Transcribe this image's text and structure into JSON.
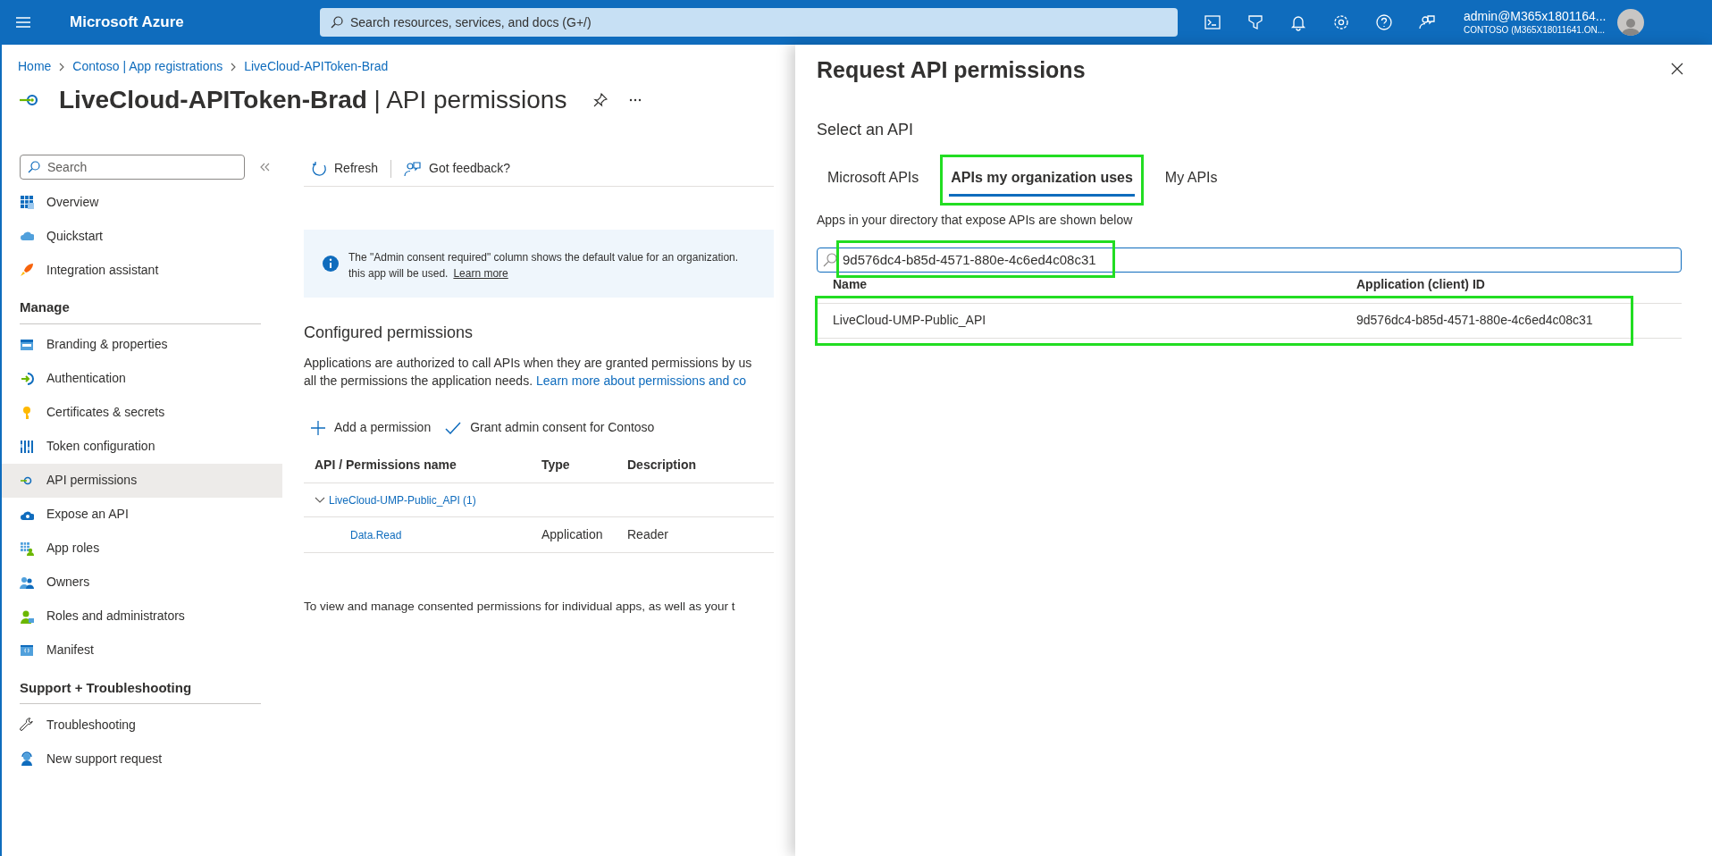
{
  "top_bar": {
    "brand": "Microsoft Azure",
    "search": {
      "placeholder": "Search resources, services, and docs (G+/)"
    },
    "account": {
      "name": "admin@M365x1801164...",
      "tenant": "CONTOSO (M365X18011641.ON..."
    }
  },
  "breadcrumb": [
    "Home",
    "Contoso | App registrations",
    "LiveCloud-APIToken-Brad"
  ],
  "page_title": "**LiveCloud-APIToken-Brad** | API permissions",
  "sidebar": {
    "search": {
      "placeholder": "Search"
    },
    "sections": [
      {
        "items": [
          {
            "label": "Overview",
            "selected": false
          },
          {
            "label": "Quickstart",
            "selected": false
          },
          {
            "label": "Integration assistant",
            "selected": false
          }
        ]
      },
      {
        "heading": "Manage",
        "items": [
          {
            "label": "Branding & properties",
            "selected": false
          },
          {
            "label": "Authentication",
            "selected": false
          },
          {
            "label": "Certificates & secrets",
            "selected": false
          },
          {
            "label": "Token configuration",
            "selected": false
          },
          {
            "label": "API permissions",
            "selected": true
          },
          {
            "label": "Expose an API",
            "selected": false
          },
          {
            "label": "App roles",
            "selected": false
          },
          {
            "label": "Owners",
            "selected": false
          },
          {
            "label": "Roles and administrators",
            "selected": false
          },
          {
            "label": "Manifest",
            "selected": false
          }
        ]
      },
      {
        "heading": "Support + Troubleshooting",
        "items": [
          {
            "label": "Troubleshooting",
            "selected": false
          },
          {
            "label": "New support request",
            "selected": false
          }
        ]
      }
    ]
  },
  "toolbar": [
    "Refresh",
    "Got feedback?"
  ],
  "info_banner": {
    "lines": [
      "The \"Admin consent required\" column shows the default value for an organization.",
      "this app will be used."
    ],
    "link": "Learn more"
  },
  "configured": {
    "heading": "Configured permissions",
    "lines": [
      "Applications are authorized to call APIs when they are granted permissions by us",
      "all the permissions the application needs."
    ],
    "link": "Learn more about permissions and co"
  },
  "actions": [
    "Add a permission",
    "Grant admin consent for Contoso"
  ],
  "permissions_table": {
    "columns": [
      "API / Permissions name",
      "Type",
      "Description"
    ],
    "groups": [
      {
        "name": "LiveCloud-UMP-Public_API (1)",
        "expanded": true,
        "rows": [
          {
            "name": "Data.Read",
            "type": "Application",
            "description": "Reader"
          }
        ]
      }
    ]
  },
  "footer_text": "To view and manage consented permissions for individual apps, as well as your t",
  "panel": {
    "title": "Request API permissions",
    "subtitle": "Select an API",
    "tabs": [
      {
        "label": "Microsoft APIs",
        "selected": false,
        "highlighted": false
      },
      {
        "label": "APIs my organization uses",
        "selected": true,
        "highlighted": true
      },
      {
        "label": "My APIs",
        "selected": false,
        "highlighted": false
      }
    ],
    "hint": "Apps in your directory that expose APIs are shown below",
    "search": {
      "value": "9d576dc4-b85d-4571-880e-4c6ed4c08c31",
      "highlighted": true
    },
    "columns": [
      "Name",
      "Application (client) ID"
    ],
    "rows": [
      {
        "name": "LiveCloud-UMP-Public_API",
        "client_id": "9d576dc4-b85d-4571-880e-4c6ed4c08c31",
        "highlighted": true
      }
    ]
  }
}
